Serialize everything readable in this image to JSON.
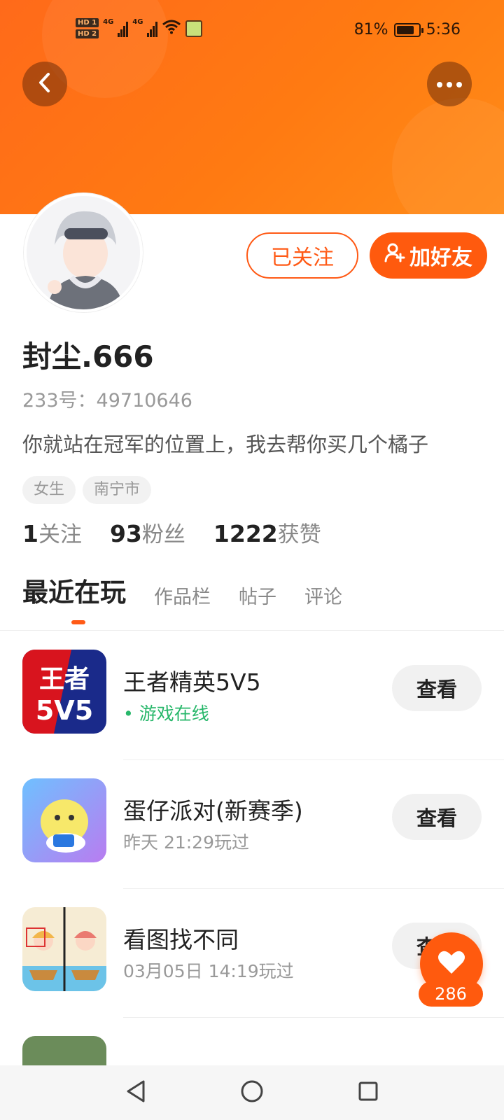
{
  "status_bar": {
    "hd1": "HD 1",
    "hd2": "HD 2",
    "net1": "4G",
    "net2": "4G",
    "battery_percent": "81%",
    "battery_level": 0.81,
    "time": "5:36"
  },
  "header": {
    "back_icon": "chevron-left-icon",
    "more_icon": "ellipsis-icon"
  },
  "profile": {
    "followed_label": "已关注",
    "add_friend_label": "加好友",
    "username": "封尘.666",
    "account_id": "233号：49710646",
    "bio": "你就站在冠军的位置上，我去帮你买几个橘子",
    "tags": [
      "女生",
      "南宁市"
    ],
    "stats": [
      {
        "num": "1",
        "label": "关注"
      },
      {
        "num": "93",
        "label": "粉丝"
      },
      {
        "num": "1222",
        "label": "获赞"
      }
    ]
  },
  "tabs": [
    "最近在玩",
    "作品栏",
    "帖子",
    "评论"
  ],
  "games": [
    {
      "title": "王者精英5V5",
      "sub": "游戏在线",
      "online": true,
      "button": "查看"
    },
    {
      "title": "蛋仔派对(新赛季)",
      "sub": "昨天 21:29玩过",
      "online": false,
      "button": "查看"
    },
    {
      "title": "看图找不同",
      "sub": "03月05日 14:19玩过",
      "online": false,
      "button": "查看"
    }
  ],
  "like": {
    "count": "286",
    "icon": "heart-icon"
  },
  "colors": {
    "accent": "#ff5a0e",
    "online": "#27b76a",
    "header_gradient_start": "#ff6a1a",
    "header_gradient_end": "#ff8c18"
  }
}
